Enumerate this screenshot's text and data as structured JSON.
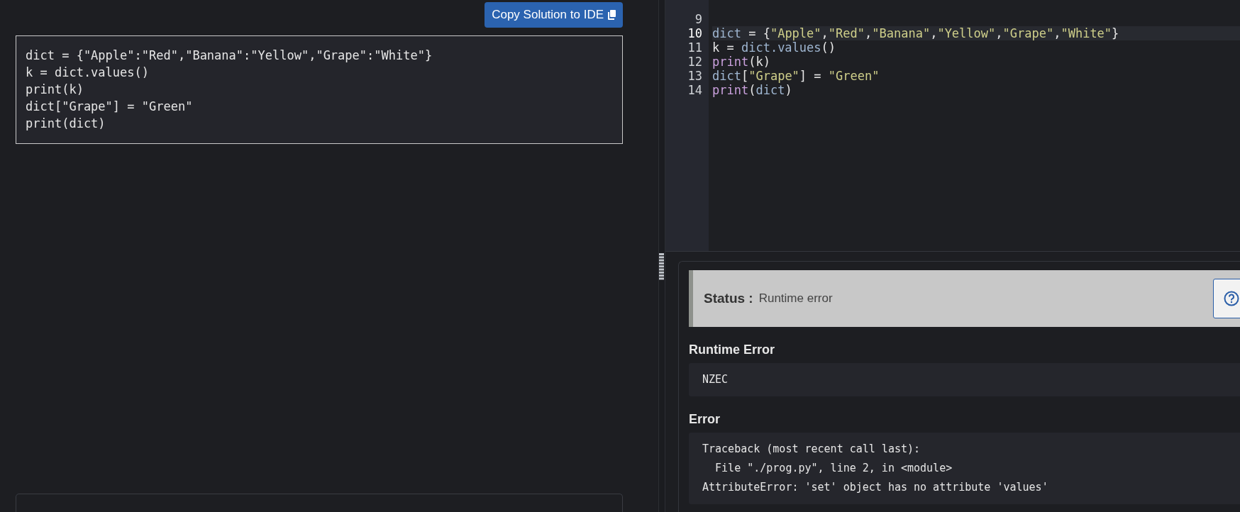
{
  "solution": {
    "copy_button": "Copy Solution to IDE",
    "code_lines": [
      "dict = {\"Apple\":\"Red\",\"Banana\":\"Yellow\",\"Grape\":\"White\"}",
      "k = dict.values()",
      "print(k)",
      "dict[\"Grape\"] = \"Green\"",
      "print(dict)"
    ]
  },
  "editor": {
    "lines": [
      {
        "number": "9",
        "current": false
      },
      {
        "number": "10",
        "current": true,
        "tokens": [
          {
            "kind": "name",
            "text": "dict"
          },
          {
            "kind": "plain",
            "text": " = {"
          },
          {
            "kind": "string",
            "text": "\"Apple\""
          },
          {
            "kind": "plain",
            "text": ","
          },
          {
            "kind": "string",
            "text": "\"Red\""
          },
          {
            "kind": "plain",
            "text": ","
          },
          {
            "kind": "string",
            "text": "\"Banana\""
          },
          {
            "kind": "plain",
            "text": ","
          },
          {
            "kind": "string",
            "text": "\"Yellow\""
          },
          {
            "kind": "plain",
            "text": ","
          },
          {
            "kind": "string",
            "text": "\"Grape\""
          },
          {
            "kind": "plain",
            "text": ","
          },
          {
            "kind": "string",
            "text": "\"White\""
          },
          {
            "kind": "plain",
            "text": "}"
          }
        ]
      },
      {
        "number": "11",
        "current": false,
        "tokens": [
          {
            "kind": "plain",
            "text": "k = "
          },
          {
            "kind": "name",
            "text": "dict.values"
          },
          {
            "kind": "plain",
            "text": "()"
          }
        ]
      },
      {
        "number": "12",
        "current": false,
        "tokens": [
          {
            "kind": "builtin",
            "text": "print"
          },
          {
            "kind": "plain",
            "text": "(k)"
          }
        ]
      },
      {
        "number": "13",
        "current": false,
        "tokens": [
          {
            "kind": "name",
            "text": "dict"
          },
          {
            "kind": "plain",
            "text": "["
          },
          {
            "kind": "string",
            "text": "\"Grape\""
          },
          {
            "kind": "plain",
            "text": "] = "
          },
          {
            "kind": "string",
            "text": "\"Green\""
          }
        ]
      },
      {
        "number": "14",
        "current": false,
        "tokens": [
          {
            "kind": "builtin",
            "text": "print"
          },
          {
            "kind": "plain",
            "text": "("
          },
          {
            "kind": "name",
            "text": "dict"
          },
          {
            "kind": "plain",
            "text": ")"
          }
        ]
      }
    ]
  },
  "result": {
    "status_label": "Status :",
    "status_value": "Runtime error",
    "sections": [
      {
        "heading": "Runtime Error",
        "lines": [
          "NZEC"
        ]
      },
      {
        "heading": "Error",
        "lines": [
          "Traceback (most recent call last):",
          "  File \"./prog.py\", line 2, in <module>",
          "AttributeError: 'set' object has no attribute 'values'"
        ]
      }
    ]
  }
}
